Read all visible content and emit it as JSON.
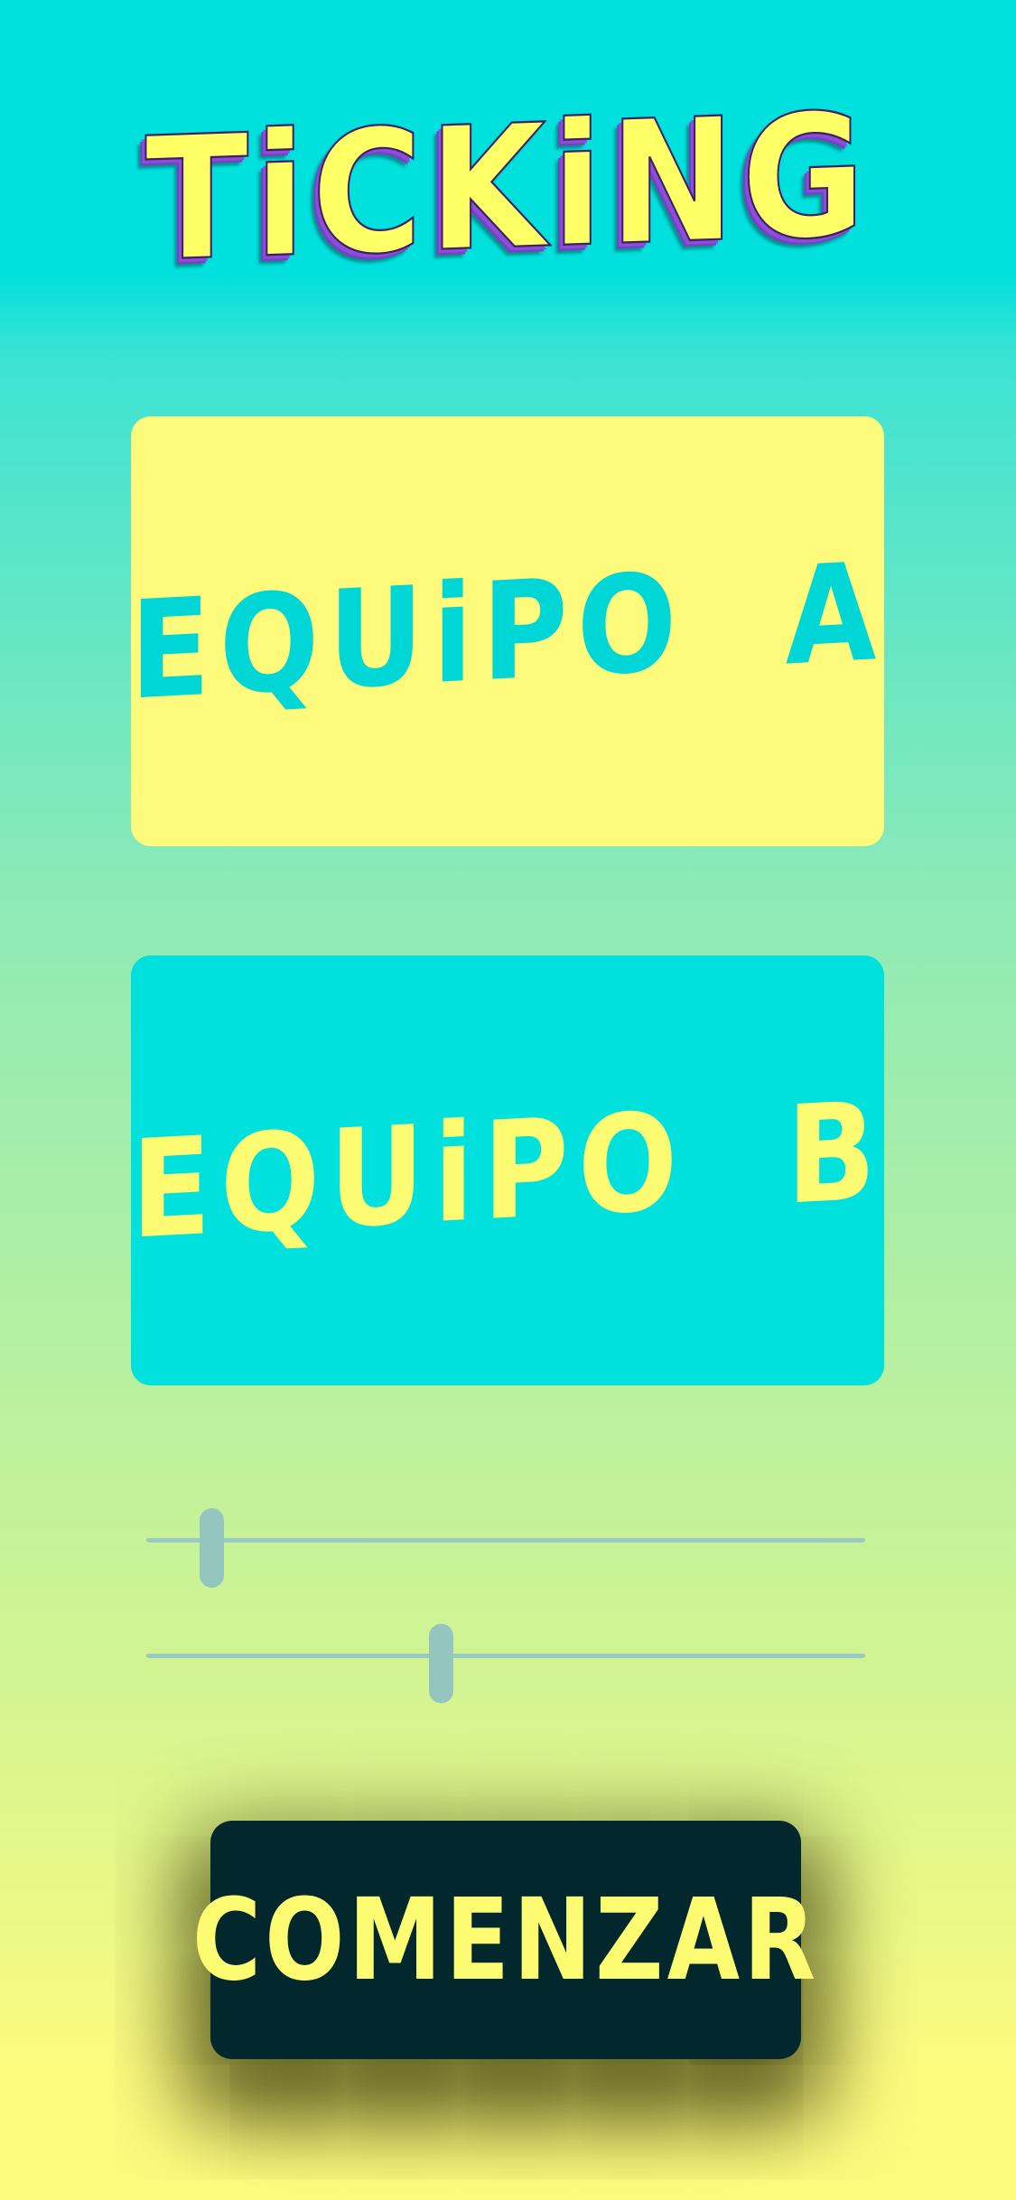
{
  "app": {
    "title": "TiCKiNG"
  },
  "teams": [
    {
      "label": "EQUiPO  A",
      "background": "#fefb7c",
      "text_color": "#00d6d6"
    },
    {
      "label": "EQUiPO  B",
      "background": "#00e0dd",
      "text_color": "#fdfb72"
    }
  ],
  "sliders": [
    {
      "name": "slider-1",
      "value": 0.09
    },
    {
      "name": "slider-2",
      "value": 0.41
    }
  ],
  "start_button": {
    "label": "COMENZAR",
    "background": "#02272c",
    "text_color": "#fdfb72"
  },
  "colors": {
    "title_fill": "#ffff66",
    "title_shadow": "#8a4fd6",
    "background_top": "#00e0dd",
    "background_bottom": "#fdfb7e",
    "slider": "#95c5bf"
  }
}
